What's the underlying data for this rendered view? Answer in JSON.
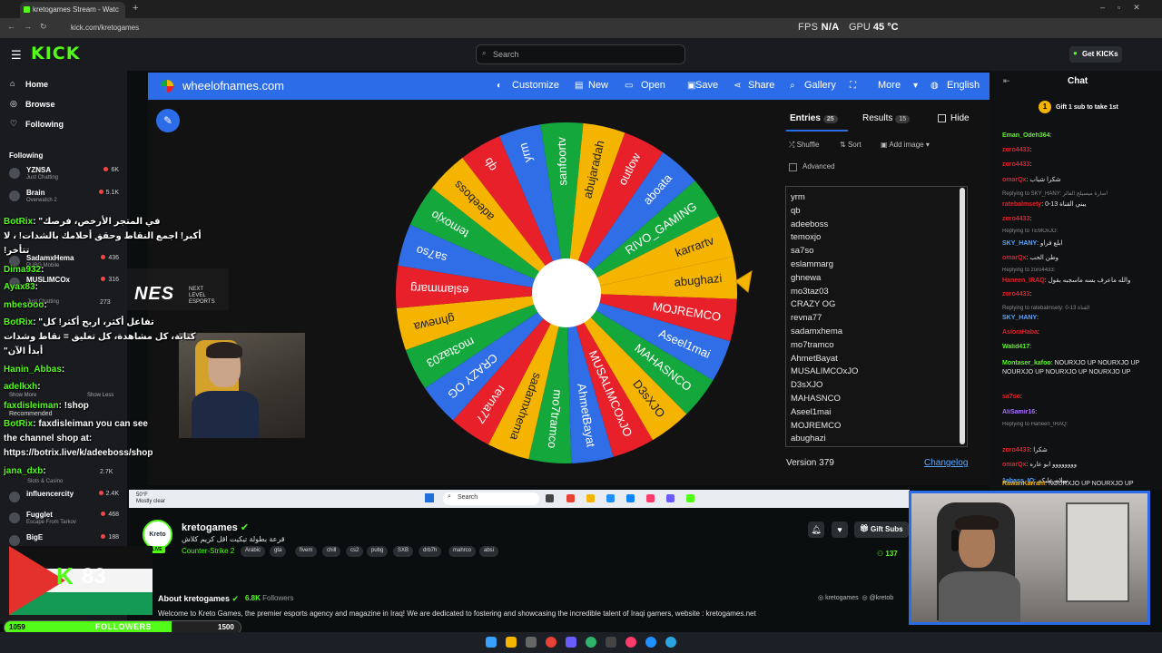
{
  "browser": {
    "tab_title": "kretogames Stream - Watc",
    "url": "kick.com/kretogames",
    "fps_label": "FPS",
    "fps_value": "N/A",
    "gpu_label": "GPU",
    "gpu_value": "45 °C"
  },
  "kick": {
    "logo": "KICK",
    "search_placeholder": "Search",
    "get_kicks": "Get KICKs",
    "nav": [
      {
        "label": "Home",
        "icon": "home-icon"
      },
      {
        "label": "Browse",
        "icon": "compass-icon"
      },
      {
        "label": "Following",
        "icon": "heart-icon"
      }
    ],
    "following_header": "Following",
    "following": [
      {
        "name": "YZNSA",
        "game": "Just Chatting",
        "viewers": "6K"
      },
      {
        "name": "Brain",
        "game": "Overwatch 2",
        "viewers": "5.1K"
      },
      {
        "name": "SadamxHema",
        "game": "PUBG Mobile",
        "viewers": "436"
      },
      {
        "name": "MUSLIMCOx",
        "game": "",
        "viewers": "316"
      },
      {
        "name": "influencercity",
        "game": "",
        "viewers": "2.4K"
      },
      {
        "name": "Fugglet",
        "game": "Escape From Tarkov",
        "viewers": "468"
      },
      {
        "name": "BigE",
        "game": "",
        "viewers": "188"
      }
    ],
    "following_partial": [
      {
        "label": "Just Chatting",
        "viewers": "273"
      },
      {
        "label": "Slots & Casino",
        "viewers": "2.7K"
      }
    ],
    "show_more": "Show More",
    "show_less": "Show Less",
    "recommended": "Recommended"
  },
  "wheel": {
    "site": "wheelofnames.com",
    "menu": [
      {
        "label": "Customize",
        "icon": "palette-icon"
      },
      {
        "label": "New",
        "icon": "file-icon"
      },
      {
        "label": "Open",
        "icon": "folder-icon"
      },
      {
        "label": "Save",
        "icon": "save-icon"
      },
      {
        "label": "Share",
        "icon": "share-icon"
      },
      {
        "label": "Gallery",
        "icon": "search-icon"
      },
      {
        "label": "More",
        "icon": "chevron-down-icon"
      },
      {
        "label": "English",
        "icon": "globe-icon"
      }
    ],
    "tab_entries": "Entries",
    "tab_entries_count": "25",
    "tab_results": "Results",
    "tab_results_count": "15",
    "hide_label": "Hide",
    "shuffle": "Shuffle",
    "sort": "Sort",
    "add_image": "Add image",
    "advanced": "Advanced",
    "entries": [
      "yrm",
      "qb",
      "adeeboss",
      "temoxjo",
      "sa7so",
      "eslammarg",
      "ghnewa",
      "mo3taz03",
      "CRAZY OG",
      "revna77",
      "sadamxhema",
      "mo7tramco",
      "AhmetBayat",
      "MUSALIMCOxJO",
      "D3sXJO",
      "MAHASNCO",
      "Aseel1mai",
      "MOJREMCO",
      "abughazi"
    ],
    "segments": [
      "abughazi",
      "MOJREMCO",
      "Aseel1mai",
      "MAHASNCO",
      "D3sXJO",
      "MUSALIMCOxJO",
      "AhmetBayat",
      "mo7tramco",
      "sadamxhema",
      "revna77",
      "CRAZY OG",
      "mo3taz03",
      "ghnewa",
      "eslammarg",
      "sa7so",
      "temoxjo",
      "adeeboss",
      "qb",
      "yrm",
      "sanfoortv",
      "abujaradah",
      "outlow",
      "aboata",
      "RIVO_GAMING",
      "karrartv"
    ],
    "segment_colors": [
      "#f5b400",
      "#e8202a",
      "#2f6ee6",
      "#14a83c"
    ],
    "version": "Version 379",
    "changelog": "Changelog"
  },
  "overlay": {
    "nes_logo": "NES",
    "nes_sub_1": "NEXT",
    "nes_sub_2": "LEVEL",
    "nes_sub_3": "ESPORTS",
    "chat": [
      {
        "user": "BotRix",
        "text": ": \"في المتجر الأرخص، فرصك"
      },
      {
        "user": "",
        "text": "أكبر! اجمع النقاط وحقق أحلامك بالشدات! ، لا"
      },
      {
        "user": "",
        "text": "!تتأخر"
      },
      {
        "user": "Dima932",
        "text": ":"
      },
      {
        "user": "Ayax83",
        "text": ":"
      },
      {
        "user": "mbesooo",
        "text": ":"
      },
      {
        "user": "BotRix",
        "text": ": \"تفاعل أكثر، اربح أكثر! كل"
      },
      {
        "user": "",
        "text": "كتابة، كل مشاهدة، كل تعليق = نقاط وشدات"
      },
      {
        "user": "",
        "text": "\"أبدأ الآن"
      },
      {
        "user": "Hanin_Abbas",
        "text": ":"
      },
      {
        "user": "adelkxh",
        "text": ":"
      },
      {
        "user": "faxdisleiman",
        "text": ": !shop"
      },
      {
        "user": "BotRix",
        "text": ": faxdisleiman you can see"
      },
      {
        "user": "",
        "text": "the channel shop at:"
      },
      {
        "user": "",
        "text": "https://botrix.live/k/adeeboss/shop"
      },
      {
        "user": "jana_dxb",
        "text": ":"
      }
    ],
    "follower_count": "83",
    "followers_current": "1059",
    "followers_label": "FOLLOWERS",
    "followers_goal": "1500",
    "followers_progress": 0.706
  },
  "stream": {
    "avatar_text": "Kreto",
    "live": "LIVE",
    "channel": "kretogames",
    "title": "قرعة بطولة تيكيت اقل كريم كلاش",
    "category": "Counter-Strike 2",
    "tags": [
      "Arabic",
      "gta",
      "fivem",
      "chill",
      "cs2",
      "pubg",
      "SXB",
      "drb7h",
      "mahrco",
      "absi"
    ],
    "gift_subs": "Gift Subs",
    "viewers": "137",
    "about": "About kretogames",
    "followers_num": "6.8K",
    "followers_word": "Followers",
    "socials": [
      "kretogames",
      "@kretob"
    ],
    "bio": "Welcome to Kreto Games, the premier esports agency and magazine in Iraq! We are dedicated to fostering and showcasing the incredible talent of Iraqi gamers, website : kretogames.net",
    "inner_weather": "50°F",
    "inner_weather_sub": "Mostly clear",
    "inner_search": "Search"
  },
  "chat": {
    "title": "Chat",
    "gift_prompt": "Gift 1 sub to take 1st",
    "messages": [
      {
        "user": "Eman_Odeh364",
        "color": "#53fc18",
        "text": ":"
      },
      {
        "user": "zoro4433",
        "color": "#e8202a",
        "text": ":"
      },
      {
        "user": "zoro4433",
        "color": "#e8202a",
        "text": ":"
      },
      {
        "user": "omarQx",
        "color": "#e8202a",
        "text": ": شكرا شباب"
      },
      {
        "user": "",
        "color": "",
        "text": "Replying to SKY_HANY: سارة ميسيلج الفائز!",
        "reply": true
      },
      {
        "user": "ratebalmsety",
        "color": "#e8202a",
        "text": ": يبني القناة 13-0"
      },
      {
        "user": "zoro4433",
        "color": "#e8202a",
        "text": ":"
      },
      {
        "user": "",
        "color": "",
        "text": "Replying to TEMOxJO:",
        "reply": true
      },
      {
        "user": "SKY_HANY",
        "color": "#58a6ff",
        "text": ": ابلع فراو"
      },
      {
        "user": "omarQx",
        "color": "#e8202a",
        "text": ": وطن الحب"
      },
      {
        "user": "",
        "color": "",
        "text": "Replying to zoro4433:",
        "reply": true
      },
      {
        "user": "Haneen_IRAQ",
        "color": "#e8202a",
        "text": ": والله ماعرف بسه ماسجبه بقول"
      },
      {
        "user": "zoro4433",
        "color": "#e8202a",
        "text": ":"
      },
      {
        "user": "",
        "color": "",
        "text": "Replying to ratebalmsety: 0-13 القناة",
        "reply": true
      },
      {
        "user": "SKY_HANY",
        "color": "#58a6ff",
        "text": ":"
      },
      {
        "user": "AsloraHaba",
        "color": "#e8202a",
        "text": ":"
      },
      {
        "user": "Walid417",
        "color": "#53fc18",
        "text": ":"
      },
      {
        "user": "Montaser_kafoo",
        "color": "#53fc18",
        "text": ": NOURXJO UP NOURXJO UP NOURXJO UP NOURXJO UP NOURXJO UP"
      },
      {
        "user": "sa7so",
        "color": "#e8202a",
        "text": ":"
      },
      {
        "user": "AliSamir16",
        "color": "#a970ff",
        "text": ":"
      },
      {
        "user": "",
        "color": "",
        "text": "Replying to Haneen_IRAQ:",
        "reply": true
      },
      {
        "user": "zoro4433",
        "color": "#e8202a",
        "text": ": شكرا"
      },
      {
        "user": "omarQx",
        "color": "#e8202a",
        "text": ": وووووووو ابو عاره"
      },
      {
        "user": "1abass_IQ",
        "color": "#58a6ff",
        "text": ": سلام عليكم"
      },
      {
        "user": "RawanKarram",
        "color": "#f5b400",
        "text": ": NOURXJO UP NOURXJO UP"
      }
    ]
  }
}
